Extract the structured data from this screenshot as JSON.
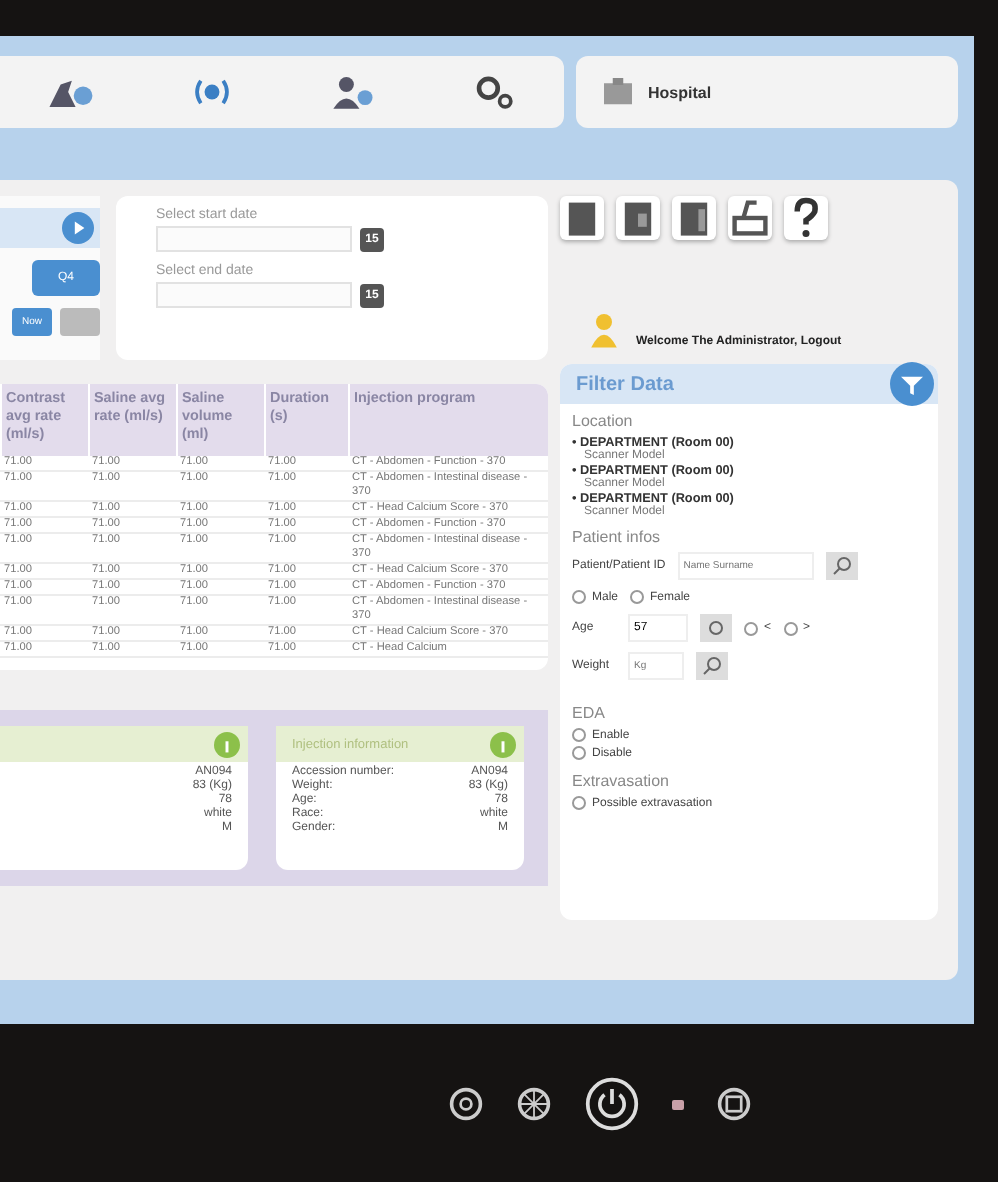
{
  "hospital": {
    "label": "Hospital"
  },
  "controls": {
    "button_primary": "Q4",
    "button_now": "Now"
  },
  "dates": [
    {
      "label": "Select start date",
      "day": "15"
    },
    {
      "label": "Select end date",
      "day": "15"
    }
  ],
  "welcome": "Welcome The Administrator, Logout",
  "table": {
    "columns": [
      "Contrast avg rate (ml/s)",
      "Saline avg rate (ml/s)",
      "Saline volume (ml)",
      "Duration (s)",
      "Injection program"
    ],
    "rows": [
      [
        "71.00",
        "71.00",
        "71.00",
        "71.00",
        "CT - Abdomen - Function - 370"
      ],
      [
        "71.00",
        "71.00",
        "71.00",
        "71.00",
        "CT - Abdomen - Intestinal disease - 370"
      ],
      [
        "71.00",
        "71.00",
        "71.00",
        "71.00",
        "CT - Head Calcium Score - 370"
      ],
      [
        "71.00",
        "71.00",
        "71.00",
        "71.00",
        "CT - Abdomen - Function - 370"
      ],
      [
        "71.00",
        "71.00",
        "71.00",
        "71.00",
        "CT - Abdomen - Intestinal disease - 370"
      ],
      [
        "71.00",
        "71.00",
        "71.00",
        "71.00",
        "CT - Head Calcium Score - 370"
      ],
      [
        "71.00",
        "71.00",
        "71.00",
        "71.00",
        "CT - Abdomen - Function - 370"
      ],
      [
        "71.00",
        "71.00",
        "71.00",
        "71.00",
        "CT - Abdomen - Intestinal disease - 370"
      ],
      [
        "71.00",
        "71.00",
        "71.00",
        "71.00",
        "CT - Head Calcium Score - 370"
      ],
      [
        "71.00",
        "71.00",
        "71.00",
        "71.00",
        "CT - Head Calcium"
      ]
    ]
  },
  "cards": [
    {
      "rows": [
        {
          "value": "AN094"
        },
        {
          "value": "83 (Kg)"
        },
        {
          "value": "78"
        },
        {
          "value": "white"
        },
        {
          "value": "M"
        }
      ]
    },
    {
      "title": "Injection information",
      "rows": [
        {
          "label": "Accession number:",
          "value": "AN094"
        },
        {
          "label": "Weight:",
          "value": "83 (Kg)"
        },
        {
          "label": "Age:",
          "value": "78"
        },
        {
          "label": "Race:",
          "value": "white"
        },
        {
          "label": "Gender:",
          "value": "M"
        }
      ]
    }
  ],
  "filter": {
    "title": "Filter Data",
    "location_heading": "Location",
    "locations": [
      {
        "department": "• DEPARTMENT (Room 00)",
        "model": "Scanner Model"
      },
      {
        "department": "• DEPARTMENT (Room 00)",
        "model": "Scanner Model"
      },
      {
        "department": "• DEPARTMENT (Room 00)",
        "model": "Scanner Model"
      }
    ],
    "patient_heading": "Patient infos",
    "patient_id_label": "Patient/Patient ID",
    "patient_id_placeholder": "Name Surname",
    "sex": [
      {
        "label": "Male",
        "selected": false
      },
      {
        "label": "Female",
        "selected": false
      }
    ],
    "age_label": "Age",
    "age_value": "57",
    "age_compare": [
      {
        "label": "<",
        "selected": false
      },
      {
        "label": ">",
        "selected": false
      }
    ],
    "weight_label": "Weight",
    "weight_placeholder": "Kg",
    "eda_heading": "EDA",
    "eda": [
      {
        "label": "Enable",
        "selected": false
      },
      {
        "label": "Disable",
        "selected": false
      }
    ],
    "extravasation_heading": "Extravasation",
    "extravasation": [
      {
        "label": "Possible extravasation",
        "selected": false
      }
    ]
  }
}
